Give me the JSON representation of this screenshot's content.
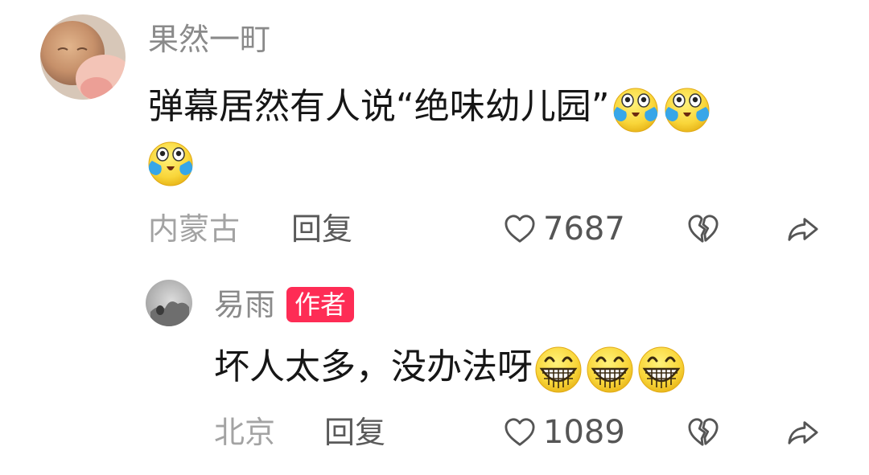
{
  "comment": {
    "author": "果然一町",
    "text": "弹幕居然有人说“绝味幼儿园”",
    "emojis": [
      "crying-laughing-emoji",
      "crying-laughing-emoji",
      "crying-laughing-emoji"
    ],
    "location": "内蒙古",
    "reply_label": "回复",
    "likes": "7687"
  },
  "reply": {
    "author": "易雨",
    "badge": "作者",
    "text": "坏人太多，没办法呀",
    "emojis": [
      "grinning-emoji",
      "grinning-emoji",
      "grinning-emoji"
    ],
    "location": "北京",
    "reply_label": "回复",
    "likes": "1089"
  },
  "icons": [
    "heart-outline-icon",
    "broken-heart-icon",
    "share-arrow-icon"
  ]
}
